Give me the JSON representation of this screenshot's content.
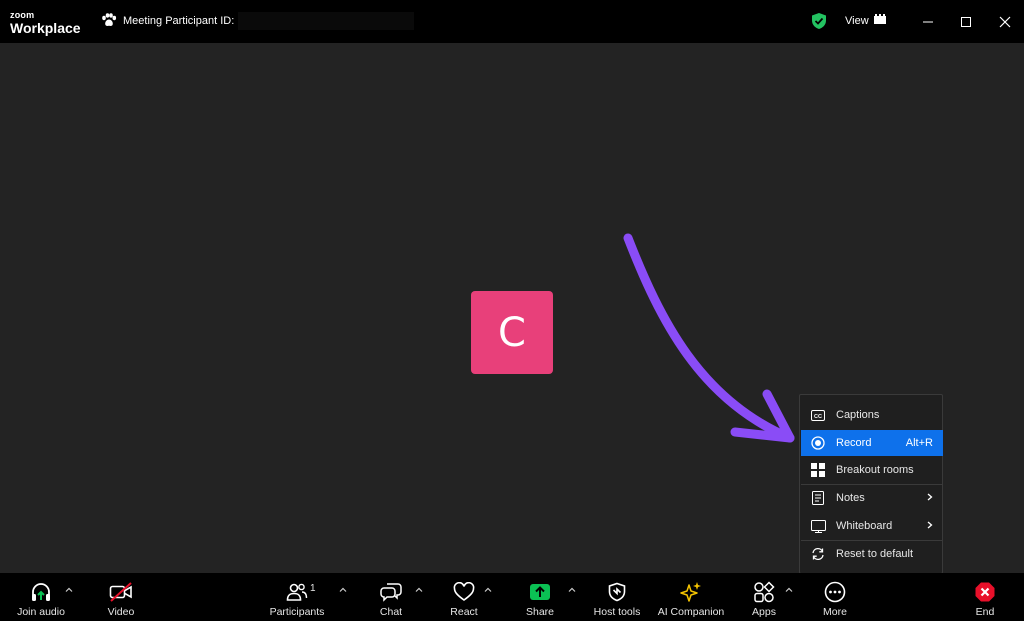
{
  "app": {
    "brand_top": "zoom",
    "brand_bottom": "Workplace"
  },
  "titlebar": {
    "meeting_label": "Meeting Participant ID:",
    "view_label": "View"
  },
  "avatar": {
    "initial": "C",
    "color": "#e8407a"
  },
  "menu": {
    "items": [
      {
        "label": "Captions",
        "icon": "captions-icon",
        "shortcut": ""
      },
      {
        "label": "Record",
        "icon": "record-icon",
        "shortcut": "Alt+R",
        "active": true
      },
      {
        "label": "Breakout rooms",
        "icon": "breakout-rooms-icon",
        "shortcut": ""
      },
      {
        "label": "Notes",
        "icon": "notes-icon",
        "submenu": true
      },
      {
        "label": "Whiteboard",
        "icon": "whiteboard-icon",
        "submenu": true
      },
      {
        "label": "Reset to default",
        "icon": "reset-icon",
        "shortcut": ""
      }
    ]
  },
  "toolbar": {
    "join_audio": "Join audio",
    "video": "Video",
    "participants": "Participants",
    "participants_count": "1",
    "chat": "Chat",
    "react": "React",
    "share": "Share",
    "host_tools": "Host tools",
    "ai_companion": "AI Companion",
    "apps": "Apps",
    "more": "More",
    "end": "End"
  },
  "colors": {
    "accent": "#0e71eb",
    "share_green": "#0bc154",
    "end_red": "#e8102a",
    "annotation_arrow": "#8a4cf6",
    "ai_yellow": "#f5c400"
  }
}
